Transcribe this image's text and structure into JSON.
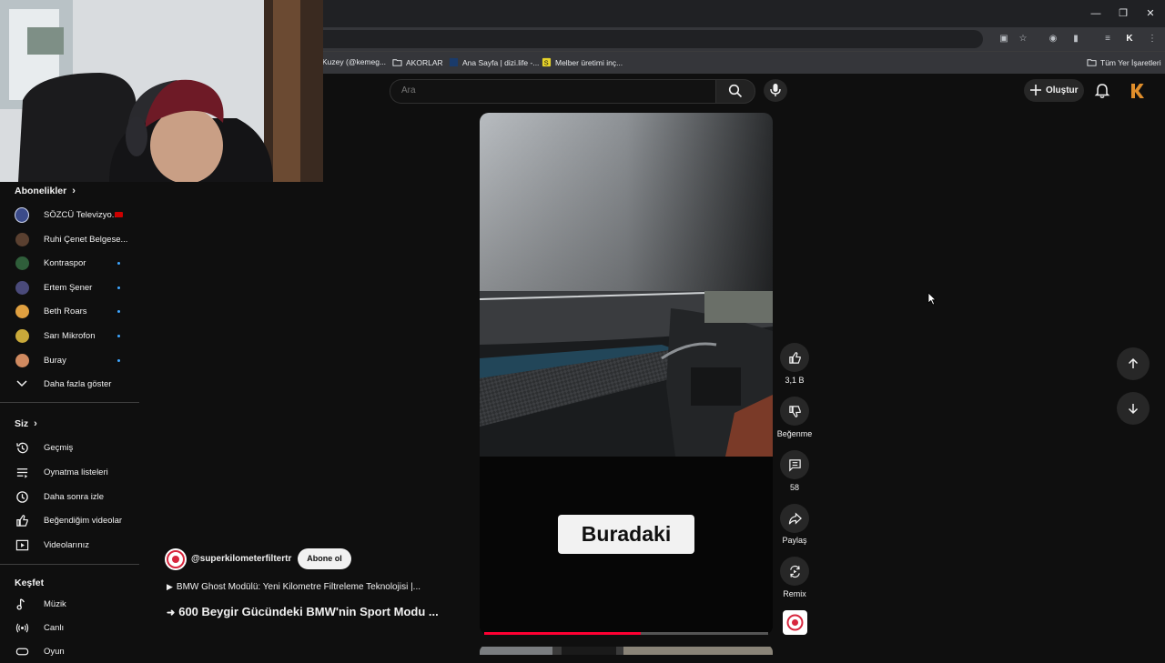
{
  "browser": {
    "bookmarks": [
      "Kuzey (@kemeg...",
      "AKORLAR",
      "Ana Sayfa | dizi.life -...",
      "Melber üretimi inç...",
      "Tüm Yer İşaretleri"
    ],
    "window_controls": [
      "minimize-icon",
      "restore-icon",
      "close-icon"
    ]
  },
  "header": {
    "search_placeholder": "Ara",
    "create_label": "Oluştur"
  },
  "sidebar": {
    "subscriptions_title": "Abonelikler",
    "subscriptions": [
      {
        "label": "SÖZCÜ Televizyo...",
        "live": true,
        "color": "#3b4b8a"
      },
      {
        "label": "Ruhi Çenet Belgese...",
        "dot": false,
        "color": "#5a4030"
      },
      {
        "label": "Kontraspor",
        "dot": true,
        "color": "#2f5e3a"
      },
      {
        "label": "Ertem Şener",
        "dot": true,
        "color": "#4a4a7a"
      },
      {
        "label": "Beth Roars",
        "dot": true,
        "color": "#e0a040"
      },
      {
        "label": "Sarı Mikrofon",
        "dot": true,
        "color": "#c9a93a"
      },
      {
        "label": "Buray",
        "dot": true,
        "color": "#d08a60"
      }
    ],
    "show_more": "Daha fazla göster",
    "you_title": "Siz",
    "you_items": [
      "Geçmiş",
      "Oynatma listeleri",
      "Daha sonra izle",
      "Beğendiğim videolar",
      "Videolarınız"
    ],
    "explore_title": "Keşfet",
    "explore_items": [
      "Müzik",
      "Canlı",
      "Oyun"
    ]
  },
  "short": {
    "caption": "Buradaki",
    "channel": "@superkilometerfiltertr",
    "subscribe": "Abone ol",
    "playlist": "BMW Ghost Modülü: Yeni Kilometre Filtreleme Teknolojisi |...",
    "title": "600 Beygir Gücündeki BMW'nin Sport Modu ...",
    "progress": 0.55,
    "actions": {
      "likes": "3,1 B",
      "dislike": "Beğenme",
      "comments": "58",
      "share": "Paylaş",
      "remix": "Remix"
    }
  }
}
